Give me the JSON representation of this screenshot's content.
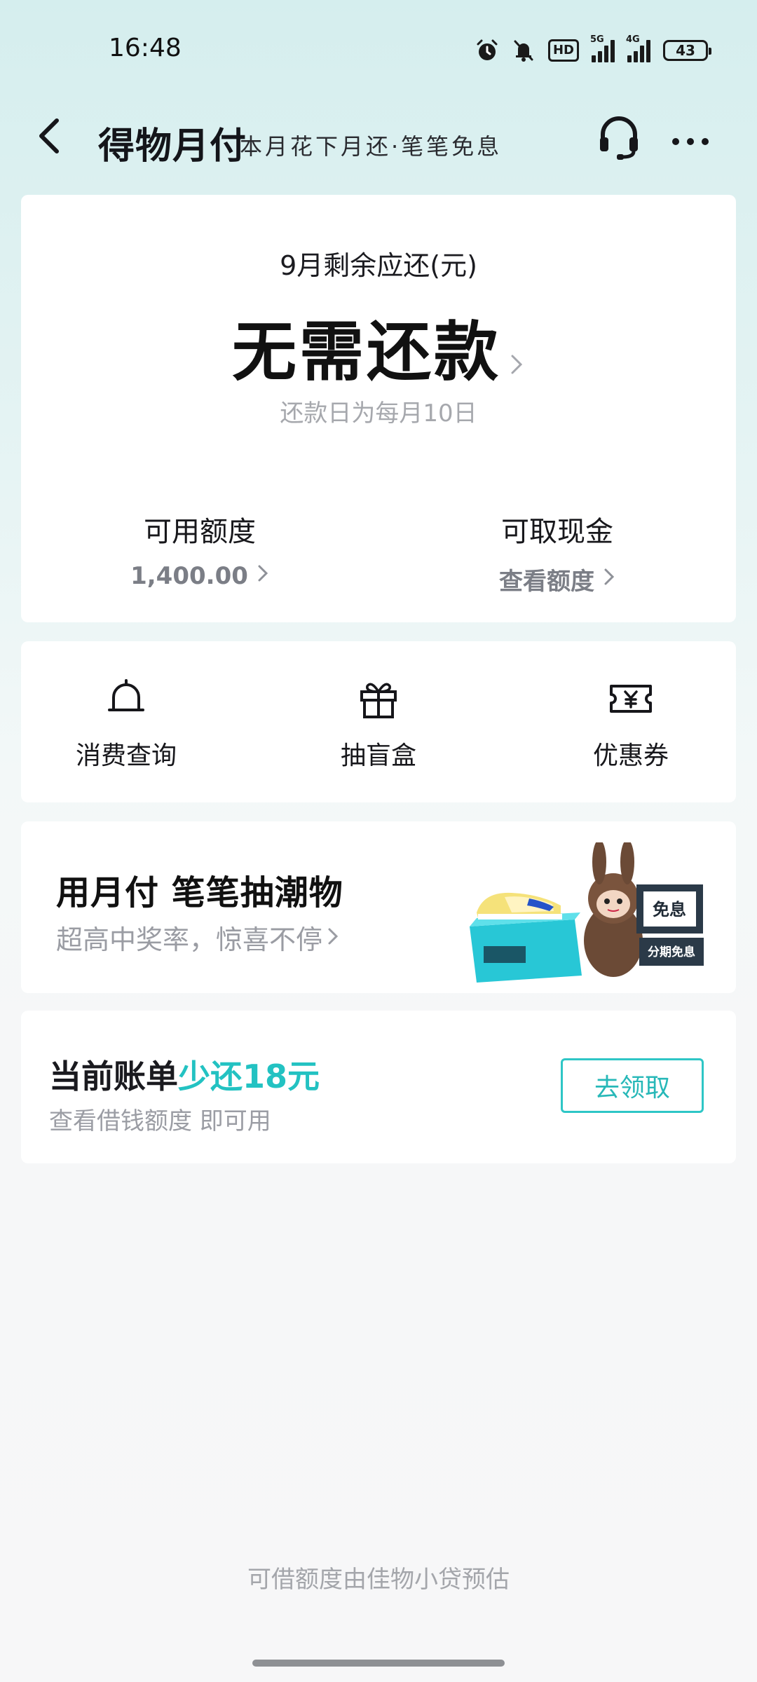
{
  "status_bar": {
    "time": "16:48",
    "hd_label": "HD",
    "net1": "5G",
    "net2": "4G",
    "battery": "43"
  },
  "header": {
    "title": "得物月付",
    "subtitle": "本月花下月还·笔笔免息",
    "icons": [
      "back-arrow-icon",
      "headset-icon",
      "more-icon"
    ]
  },
  "summary": {
    "label": "9月剩余应还(元)",
    "amount_text": "无需还款",
    "note": "还款日为每月10日",
    "left": {
      "title": "可用额度",
      "value": "1,400.00"
    },
    "right": {
      "title": "可取现金",
      "value": "查看额度"
    }
  },
  "actions": [
    {
      "label": "消费查询",
      "icon": "bell-icon"
    },
    {
      "label": "抽盲盒",
      "icon": "gift-icon"
    },
    {
      "label": "优惠券",
      "icon": "coupon-icon"
    }
  ],
  "promo": {
    "title": "用月付 笔笔抽潮物",
    "subtitle": "超高中奖率，惊喜不停",
    "badge_top": "免息",
    "badge_bottom": "分期免息"
  },
  "bill": {
    "title_prefix": "当前账单",
    "title_accent": "少还18元",
    "subtitle": "查看借钱额度 即可用",
    "button": "去领取"
  },
  "footer_note": "可借额度由佳物小贷预估",
  "colors": {
    "accent": "#23c2c2",
    "background_top": "#d5eeee",
    "card": "#ffffff",
    "muted_text": "#a6a8ad"
  }
}
